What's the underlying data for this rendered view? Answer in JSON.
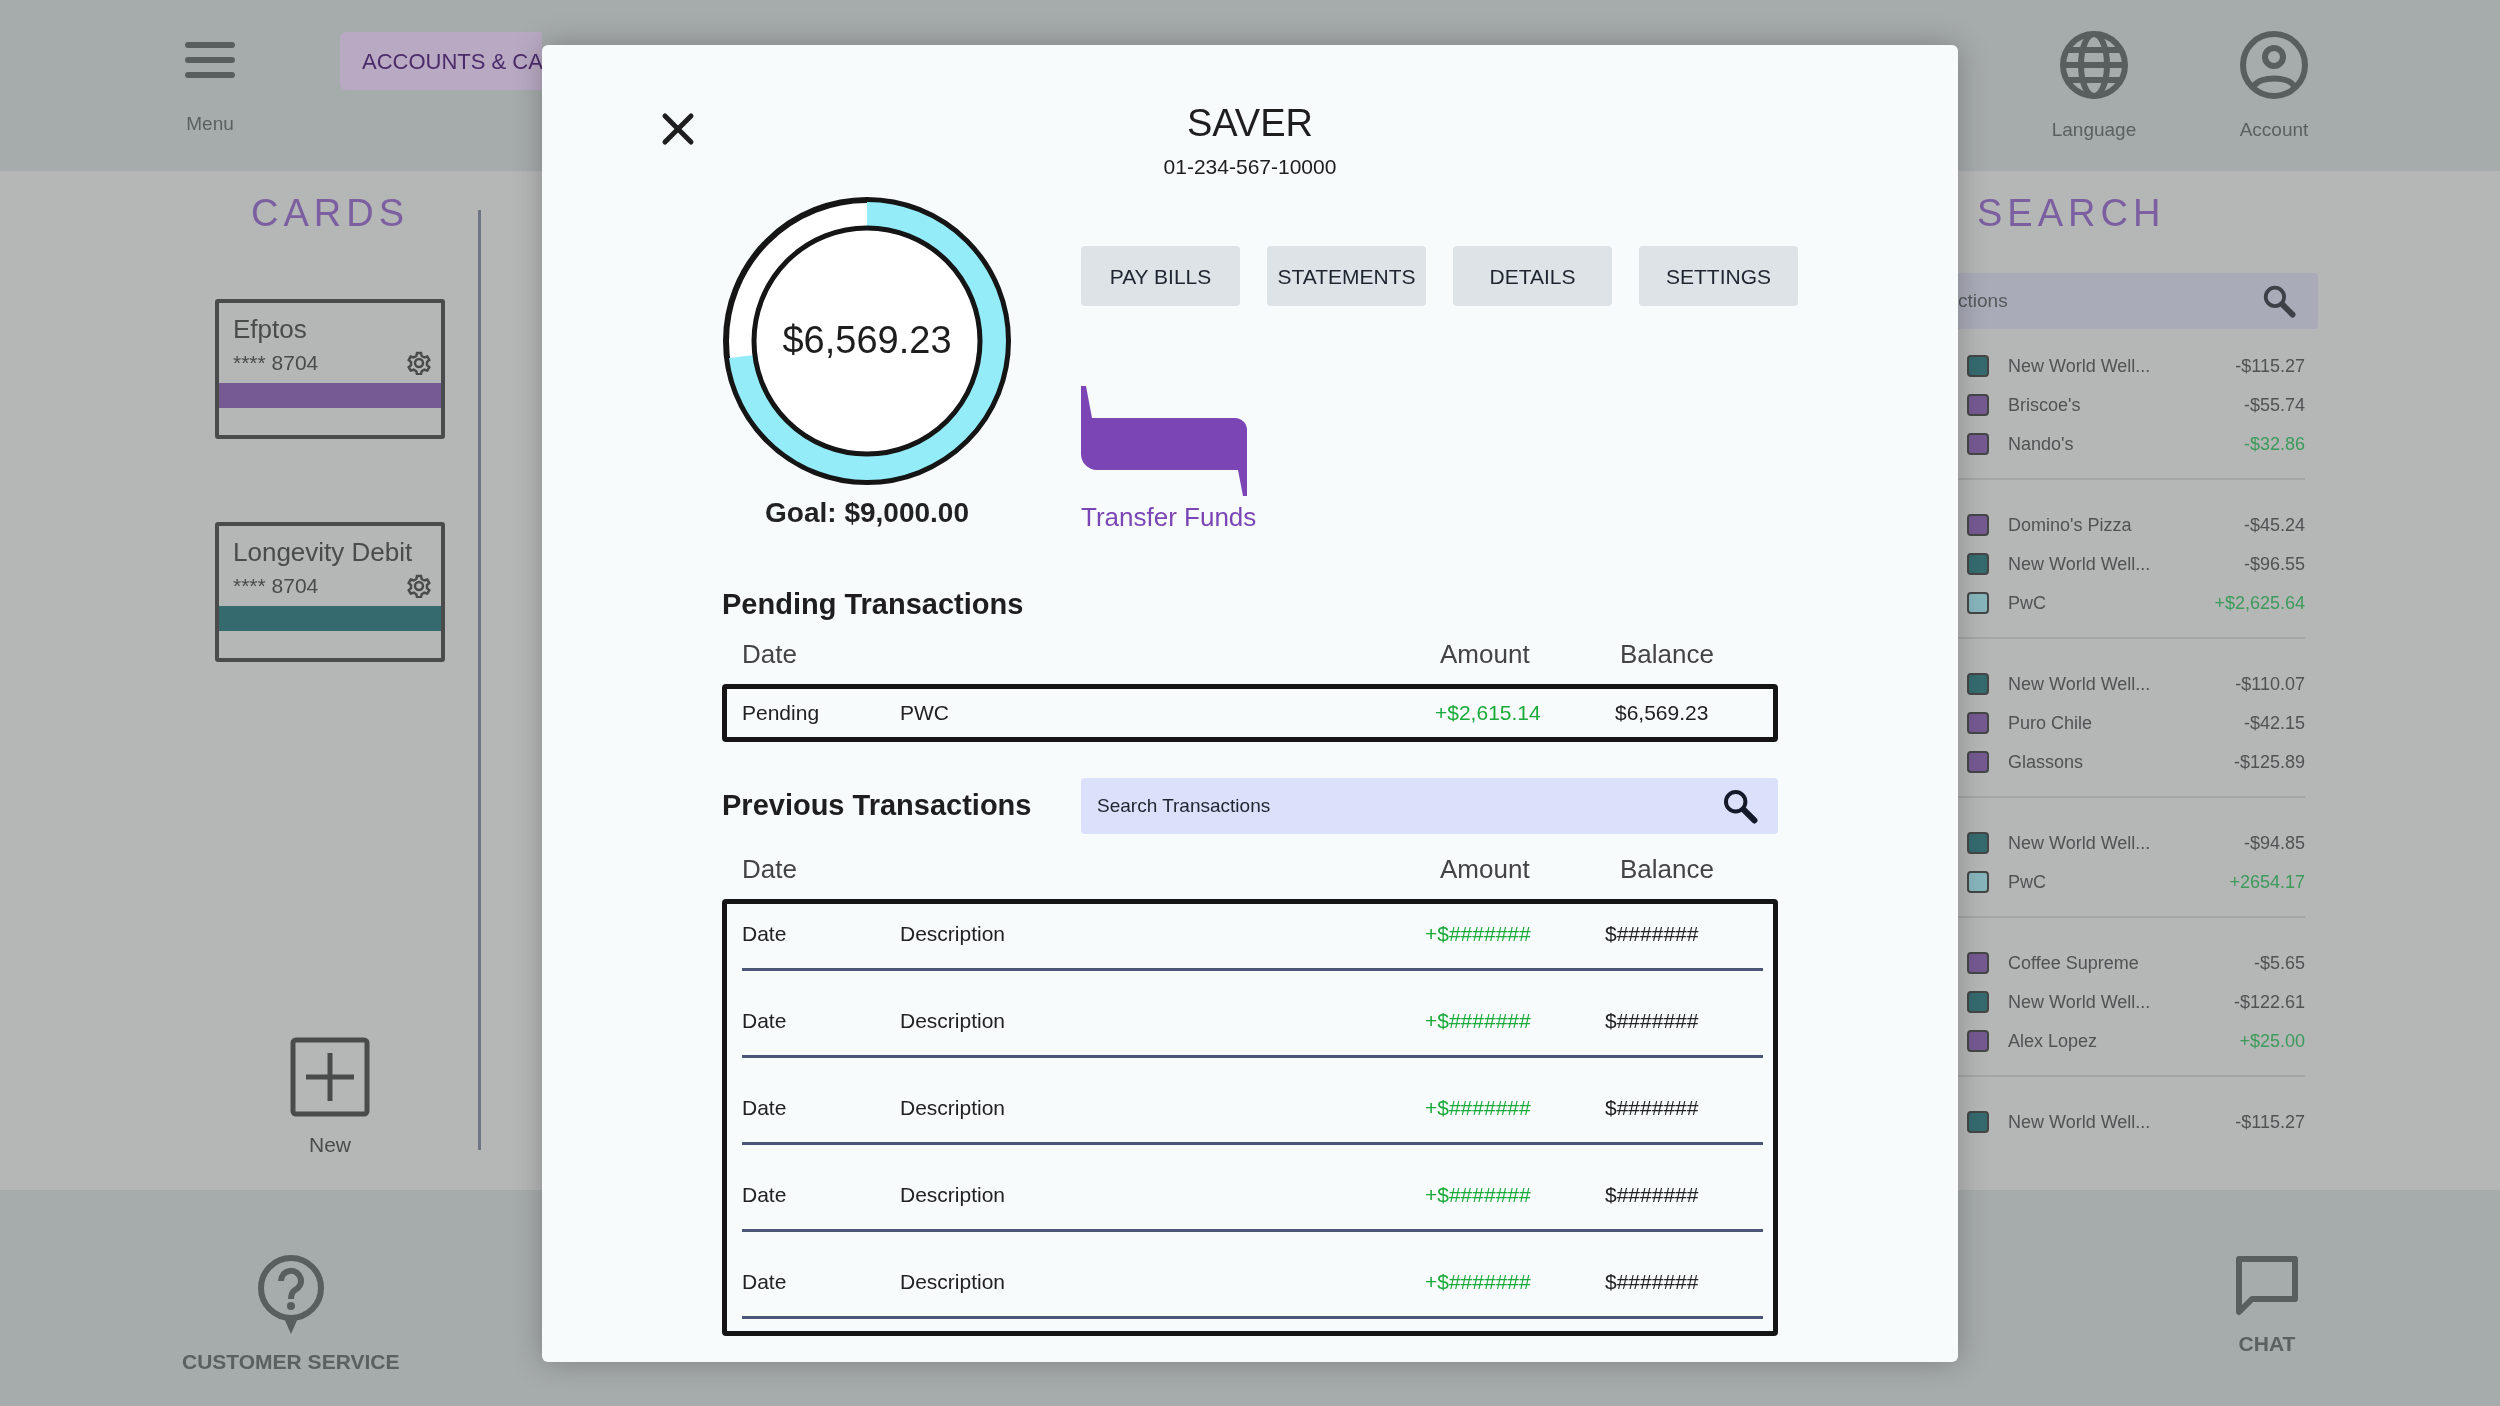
{
  "header": {
    "menu_label": "Menu",
    "tab": {
      "label": "ACCOUNTS & CA",
      "selected": true
    },
    "actions": [
      {
        "label": "Language",
        "kind": "globe"
      },
      {
        "label": "Account",
        "kind": "user"
      }
    ]
  },
  "cards_panel": {
    "title": "CARDS",
    "new_label": "New",
    "cards": [
      {
        "name": "Efptos",
        "number": "**** 8704",
        "color": "#755a93"
      },
      {
        "name": "Longevity Debit",
        "number": "**** 8704",
        "color": "#356b6f"
      }
    ]
  },
  "search_panel": {
    "title": "SEARCH",
    "search": {
      "placeholder": "ctions"
    },
    "groups": [
      [
        {
          "name": "New World Well...",
          "amount": "-$115.27",
          "color": "#356b6f",
          "credit": false
        },
        {
          "name": "Briscoe's",
          "amount": "-$55.74",
          "color": "#755a93",
          "credit": false
        },
        {
          "name": "Nando's",
          "amount": "-$32.86",
          "color": "#755a93",
          "credit": true
        }
      ],
      [
        {
          "name": "Domino's Pizza",
          "amount": "-$45.24",
          "color": "#755a93",
          "credit": false
        },
        {
          "name": "New World Well...",
          "amount": "-$96.55",
          "color": "#356b6f",
          "credit": false
        },
        {
          "name": "PwC",
          "amount": "+$2,625.64",
          "color": "#87b6bd",
          "credit": true
        }
      ],
      [
        {
          "name": "New World Well...",
          "amount": "-$110.07",
          "color": "#356b6f",
          "credit": false
        },
        {
          "name": "Puro Chile",
          "amount": "-$42.15",
          "color": "#755a93",
          "credit": false
        },
        {
          "name": "Glassons",
          "amount": "-$125.89",
          "color": "#755a93",
          "credit": false
        }
      ],
      [
        {
          "name": "New World Well...",
          "amount": "-$94.85",
          "color": "#356b6f",
          "credit": false
        },
        {
          "name": "PwC",
          "amount": "+2654.17",
          "color": "#87b6bd",
          "credit": true
        }
      ],
      [
        {
          "name": "Coffee Supreme",
          "amount": "-$5.65",
          "color": "#755a93",
          "credit": false
        },
        {
          "name": "New World Well...",
          "amount": "-$122.61",
          "color": "#356b6f",
          "credit": false
        },
        {
          "name": "Alex Lopez",
          "amount": "+$25.00",
          "color": "#755a93",
          "credit": true
        }
      ],
      [
        {
          "name": "New World Well...",
          "amount": "-$115.27",
          "color": "#356b6f",
          "credit": false
        }
      ]
    ]
  },
  "footer": {
    "items": [
      {
        "label": "CUSTOMER SERVICE",
        "kind": "help"
      },
      {
        "label": "CHAT",
        "kind": "chat"
      }
    ]
  },
  "modal": {
    "title": "SAVER",
    "account_number": "01-234-567-10000",
    "balance": "$6,569.23",
    "goal": "Goal: $9,000.00",
    "level": 0.73,
    "buttons": [
      "PAY BILLS",
      "STATEMENTS",
      "DETAILS",
      "SETTINGS"
    ],
    "transfer_label": "Transfer Funds",
    "pending": {
      "title": "Pending Transactions",
      "columns": {
        "date": "Date",
        "amount": "Amount",
        "balance": "Balance"
      },
      "rows": [
        {
          "date": "Pending",
          "description": "PWC",
          "amount": "+$2,615.14",
          "balance": "$6,569.23",
          "credit": true
        }
      ]
    },
    "previous": {
      "title": "Previous Transactions",
      "search": {
        "placeholder": "Search Transactions"
      },
      "columns": {
        "date": "Date",
        "amount": "Amount",
        "balance": "Balance"
      },
      "rows": [
        {
          "date": "Date",
          "description": "Description",
          "amount": "+$#######",
          "balance": "$#######",
          "credit": true
        },
        {
          "date": "Date",
          "description": "Description",
          "amount": "+$#######",
          "balance": "$#######",
          "credit": true
        },
        {
          "date": "Date",
          "description": "Description",
          "amount": "+$#######",
          "balance": "$#######",
          "credit": true
        },
        {
          "date": "Date",
          "description": "Description",
          "amount": "+$#######",
          "balance": "$#######",
          "credit": true
        },
        {
          "date": "Date",
          "description": "Description",
          "amount": "+$#######",
          "balance": "$#######",
          "credit": true
        }
      ]
    }
  }
}
